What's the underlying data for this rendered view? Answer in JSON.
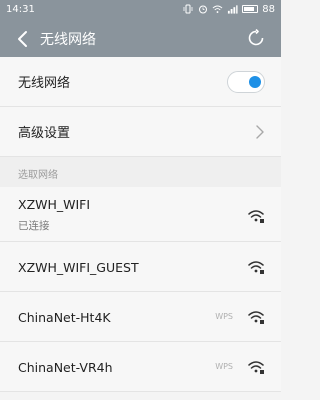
{
  "status_bar": {
    "time": "14:31",
    "battery_text": "88"
  },
  "header": {
    "title": "无线网络"
  },
  "settings": {
    "wifi_toggle_label": "无线网络",
    "wifi_enabled": true,
    "advanced_label": "高级设置"
  },
  "section": {
    "choose_network_label": "选取网络"
  },
  "networks": [
    {
      "ssid": "XZWH_WIFI",
      "status": "已连接",
      "wps": ""
    },
    {
      "ssid": "XZWH_WIFI_GUEST",
      "status": "",
      "wps": ""
    },
    {
      "ssid": "ChinaNet-Ht4K",
      "status": "",
      "wps": "WPS"
    },
    {
      "ssid": "ChinaNet-VR4h",
      "status": "",
      "wps": "WPS"
    }
  ],
  "colors": {
    "header_bg": "#8a949c",
    "accent": "#1e90e6"
  }
}
